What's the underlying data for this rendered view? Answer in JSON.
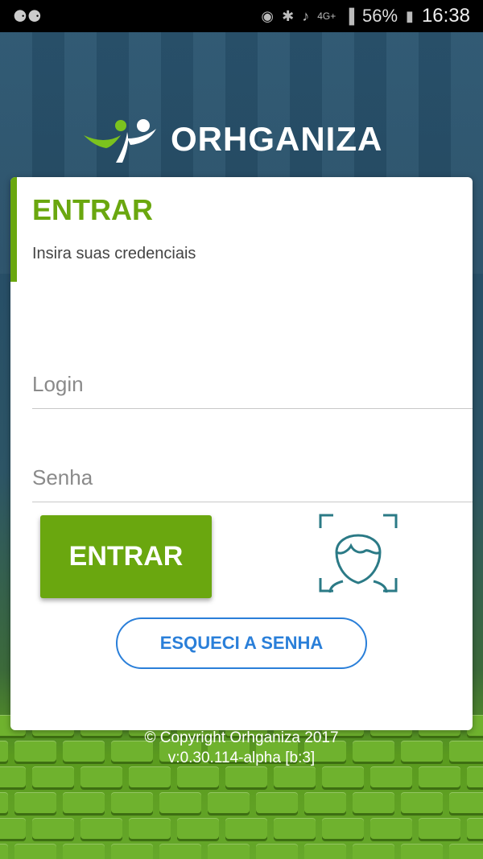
{
  "status_bar": {
    "left_icon": "voicemail-icon",
    "battery": "56%",
    "time": "16:38",
    "network": "4G+"
  },
  "logo": {
    "text": "ORHGANIZA"
  },
  "card": {
    "title": "ENTRAR",
    "subtitle": "Insira suas credenciais"
  },
  "form": {
    "login_placeholder": "Login",
    "login_value": "",
    "password_placeholder": "Senha",
    "password_value": "",
    "submit_label": "ENTRAR",
    "face_icon": "face-recognition-icon",
    "forgot_label": "ESQUECI A SENHA"
  },
  "footer": {
    "copyright": "© Copyright Orhganiza 2017",
    "version": "v:0.30.114-alpha [b:3]"
  },
  "colors": {
    "accent_green": "#6aa70f",
    "link_blue": "#2a7fd9",
    "face_icon_teal": "#2b7a86"
  }
}
